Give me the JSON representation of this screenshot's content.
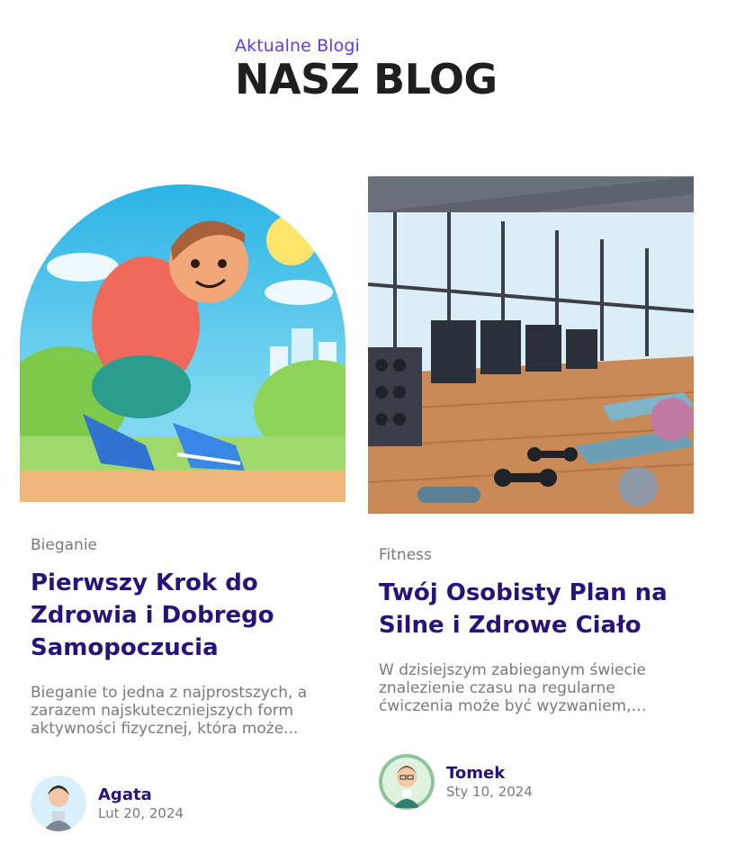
{
  "header": {
    "eyebrow": "Aktualne Blogi",
    "title": "NASZ BLOG"
  },
  "posts": [
    {
      "category": "Bieganie",
      "title": "Pierwszy Krok do Zdrowia i Dobrego Samopoczucia",
      "excerpt": "Bieganie to jedna z najprostszych, a zarazem najskuteczniejszych form aktywności fizycznej, która może...",
      "author": "Agata",
      "date": "Lut 20, 2024",
      "image_icon": "runner-tying-shoe-illustration"
    },
    {
      "category": "Fitness",
      "title": "Twój Osobisty Plan na Silne i Zdrowe Ciało",
      "excerpt": "W dzisiejszym zabieganym świecie znalezienie czasu na regularne ćwiczenia może być wyzwaniem, ale...",
      "author": "Tomek",
      "date": "Sty 10, 2024",
      "image_icon": "gym-interior-illustration"
    }
  ]
}
